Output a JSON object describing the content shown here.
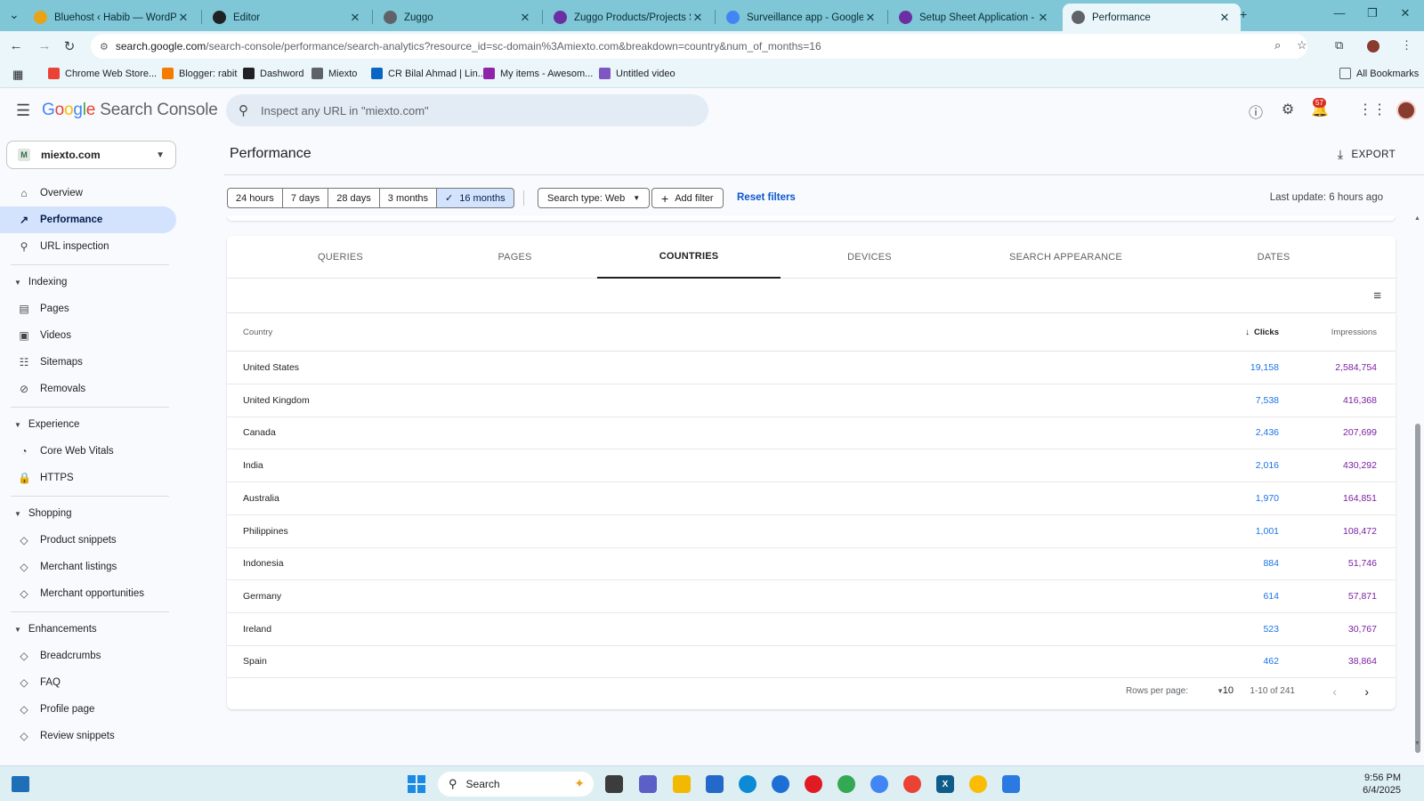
{
  "browser": {
    "tabs": [
      {
        "title": "Bluehost ‹ Habib — WordPress",
        "icon": "wordpress-icon",
        "color": "#e8a317"
      },
      {
        "title": "Editor",
        "icon": "editor-icon",
        "color": "#202124"
      },
      {
        "title": "Zuggo",
        "icon": "globe-icon",
        "color": "#5f6368"
      },
      {
        "title": "Zuggo Products/Projects Show",
        "icon": "gear-icon",
        "color": "#6b2fa3"
      },
      {
        "title": "Surveillance app - Google Sear",
        "icon": "google-icon",
        "color": "#4285f4"
      },
      {
        "title": "Setup Sheet Application - Zugg",
        "icon": "gear-icon",
        "color": "#6b2fa3"
      },
      {
        "title": "Performance",
        "icon": "search-console-icon",
        "color": "#5f6368"
      }
    ],
    "url_host": "search.google.com",
    "url_rest": "/search-console/performance/search-analytics?resource_id=sc-domain%3Amiexto.com&breakdown=country&num_of_months=16",
    "bookmarks": [
      {
        "label": "Chrome Web Store...",
        "color": "#ea4335"
      },
      {
        "label": "Blogger: rabit",
        "color": "#f57c00"
      },
      {
        "label": "Dashword",
        "color": "#202124"
      },
      {
        "label": "Miexto",
        "color": "#5f6368"
      },
      {
        "label": "CR Bilal Ahmad | Lin...",
        "color": "#0a66c2"
      },
      {
        "label": "My items - Awesom...",
        "color": "#8e24aa"
      },
      {
        "label": "Untitled video",
        "color": "#7e57c2"
      }
    ],
    "all_bookmarks": "All Bookmarks"
  },
  "header": {
    "logo_google": "Google",
    "logo_product": "Search Console",
    "inspect_placeholder": "Inspect any URL in \"miexto.com\"",
    "notifications_count": "57"
  },
  "sidebar": {
    "property": "miexto.com",
    "top_items": [
      {
        "label": "Overview",
        "icon": "home-icon"
      },
      {
        "label": "Performance",
        "icon": "trending-up-icon",
        "active": true
      },
      {
        "label": "URL inspection",
        "icon": "search-icon"
      }
    ],
    "sections": [
      {
        "title": "Indexing",
        "items": [
          "Pages",
          "Videos",
          "Sitemaps",
          "Removals"
        ]
      },
      {
        "title": "Experience",
        "items": [
          "Core Web Vitals",
          "HTTPS"
        ]
      },
      {
        "title": "Shopping",
        "items": [
          "Product snippets",
          "Merchant listings",
          "Merchant opportunities"
        ]
      },
      {
        "title": "Enhancements",
        "items": [
          "Breadcrumbs",
          "FAQ",
          "Profile page",
          "Review snippets"
        ]
      }
    ]
  },
  "main": {
    "title": "Performance",
    "export_label": "EXPORT",
    "date_ranges": [
      "24 hours",
      "7 days",
      "28 days",
      "3 months",
      "16 months"
    ],
    "selected_range": "16 months",
    "search_type": "Search type: Web",
    "add_filter": "Add filter",
    "reset_filters": "Reset filters",
    "last_update": "Last update: 6 hours ago",
    "tabs": [
      "QUERIES",
      "PAGES",
      "COUNTRIES",
      "DEVICES",
      "SEARCH APPEARANCE",
      "DATES"
    ],
    "selected_tab": "COUNTRIES",
    "columns": {
      "country": "Country",
      "clicks": "Clicks",
      "impressions": "Impressions"
    },
    "rows": [
      {
        "country": "United States",
        "clicks": "19,158",
        "impressions": "2,584,754"
      },
      {
        "country": "United Kingdom",
        "clicks": "7,538",
        "impressions": "416,368"
      },
      {
        "country": "Canada",
        "clicks": "2,436",
        "impressions": "207,699"
      },
      {
        "country": "India",
        "clicks": "2,016",
        "impressions": "430,292"
      },
      {
        "country": "Australia",
        "clicks": "1,970",
        "impressions": "164,851"
      },
      {
        "country": "Philippines",
        "clicks": "1,001",
        "impressions": "108,472"
      },
      {
        "country": "Indonesia",
        "clicks": "884",
        "impressions": "51,746"
      },
      {
        "country": "Germany",
        "clicks": "614",
        "impressions": "57,871"
      },
      {
        "country": "Ireland",
        "clicks": "523",
        "impressions": "30,767"
      },
      {
        "country": "Spain",
        "clicks": "462",
        "impressions": "38,864"
      }
    ],
    "pager": {
      "rows_per_page_label": "Rows per page:",
      "rows_per_page": "10",
      "range": "1-10 of 241"
    }
  },
  "taskbar": {
    "search_label": "Search",
    "time": "9:56 PM",
    "date": "6/4/2025",
    "colors": {
      "accent": "#1a8ae6"
    }
  }
}
